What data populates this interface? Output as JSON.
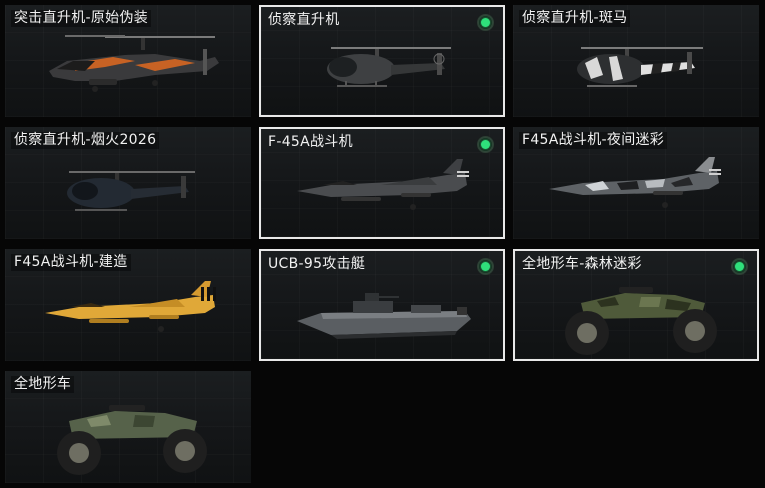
{
  "items": [
    {
      "name": "突击直升机-原始伪装",
      "selected": false,
      "equipped": false,
      "icon": "attack-helicopter-icon"
    },
    {
      "name": "侦察直升机",
      "selected": true,
      "equipped": true,
      "icon": "scout-helicopter-icon"
    },
    {
      "name": "侦察直升机-斑马",
      "selected": false,
      "equipped": false,
      "icon": "scout-helicopter-icon"
    },
    {
      "name": "侦察直升机-烟火2026",
      "selected": false,
      "equipped": false,
      "icon": "scout-helicopter-icon"
    },
    {
      "name": "F-45A战斗机",
      "selected": true,
      "equipped": true,
      "icon": "fighter-jet-icon"
    },
    {
      "name": "F45A战斗机-夜间迷彩",
      "selected": false,
      "equipped": false,
      "icon": "fighter-jet-icon"
    },
    {
      "name": "F45A战斗机-建造",
      "selected": false,
      "equipped": false,
      "icon": "fighter-jet-icon"
    },
    {
      "name": "UCB-95攻击艇",
      "selected": true,
      "equipped": true,
      "icon": "attack-boat-icon"
    },
    {
      "name": "全地形车-森林迷彩",
      "selected": true,
      "equipped": true,
      "icon": "atv-icon"
    },
    {
      "name": "全地形车",
      "selected": false,
      "equipped": false,
      "icon": "atv-icon"
    }
  ],
  "colors": {
    "background": "#060606",
    "card": "#17191b",
    "selected_border": "#e8e8e8",
    "status_green": "#2fe07b",
    "text": "#f2f2f2"
  }
}
